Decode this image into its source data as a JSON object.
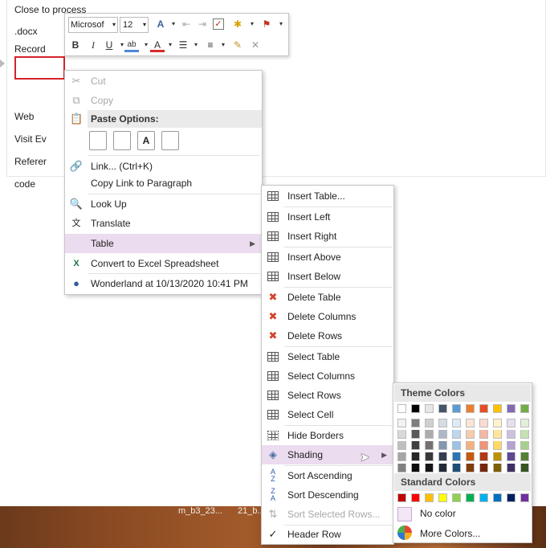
{
  "document": {
    "cells": [
      "Close to process",
      ".docx",
      "Record",
      "Web",
      "Visit Ev",
      "Referer",
      "code"
    ]
  },
  "mini_toolbar": {
    "font_name": "Microsof",
    "font_size": "12",
    "icons": [
      "grow-font-icon",
      "decrease-indent-icon",
      "increase-indent-icon",
      "checkbox-icon",
      "styles-icon",
      "flag-icon",
      "bold-icon",
      "italic-icon",
      "underline-icon",
      "highlight-icon",
      "font-color-icon",
      "bullets-icon",
      "numbering-icon",
      "format-painter-icon",
      "clear-format-icon"
    ],
    "bold": "B",
    "italic": "I",
    "underline": "U"
  },
  "context_menu": {
    "cut": "Cut",
    "copy": "Copy",
    "paste_options": "Paste Options:",
    "link": "Link...  (Ctrl+K)",
    "copy_link": "Copy Link to Paragraph",
    "look_up": "Look Up",
    "translate": "Translate",
    "table": "Table",
    "convert": "Convert to Excel Spreadsheet",
    "author": "Wonderland at 10/13/2020 10:41 PM"
  },
  "table_submenu": {
    "items": [
      "Insert Table...",
      "Insert Left",
      "Insert Right",
      "Insert Above",
      "Insert Below",
      "Delete Table",
      "Delete Columns",
      "Delete Rows",
      "Select Table",
      "Select Columns",
      "Select Rows",
      "Select Cell",
      "Hide Borders",
      "Shading",
      "Sort Ascending",
      "Sort Descending",
      "Sort Selected Rows...",
      "Header Row"
    ]
  },
  "shading_panel": {
    "theme_header": "Theme Colors",
    "standard_header": "Standard Colors",
    "no_color": "No color",
    "more_colors": "More Colors...",
    "theme_top": [
      "#ffffff",
      "#000000",
      "#e7e6e6",
      "#44546a",
      "#5b9bd5",
      "#ed7d31",
      "#e84c22",
      "#ffc000",
      "#7f6ab3",
      "#70ad47"
    ],
    "theme_columns": [
      [
        "#f2f2f2",
        "#d9d9d9",
        "#bfbfbf",
        "#a6a6a6",
        "#808080"
      ],
      [
        "#7f7f7f",
        "#595959",
        "#404040",
        "#262626",
        "#0d0d0d"
      ],
      [
        "#d0cece",
        "#aeabab",
        "#757171",
        "#3a3838",
        "#171616"
      ],
      [
        "#d6dce4",
        "#adb9ca",
        "#8497b0",
        "#333f4f",
        "#222a35"
      ],
      [
        "#deebf6",
        "#bdd7ee",
        "#9cc3e5",
        "#2e75b5",
        "#1f4e79"
      ],
      [
        "#fbe5d5",
        "#f7cbac",
        "#f4b083",
        "#c55a11",
        "#833c0b"
      ],
      [
        "#fadbd2",
        "#f5b7a5",
        "#f19379",
        "#b23914",
        "#77260d"
      ],
      [
        "#fff2cc",
        "#fee599",
        "#ffd965",
        "#bf9000",
        "#7f6000"
      ],
      [
        "#e5e0f0",
        "#ccc1e1",
        "#b2a3d1",
        "#5d4893",
        "#3e3062"
      ],
      [
        "#e2efd9",
        "#c5e0b3",
        "#a8d08d",
        "#538135",
        "#375623"
      ]
    ],
    "standard": [
      "#c00000",
      "#ff0000",
      "#ffc000",
      "#ffff00",
      "#92d050",
      "#00b050",
      "#00b0f0",
      "#0070c0",
      "#002060",
      "#7030a0"
    ]
  },
  "background": {
    "taskbar_text_1": "m_b3_23...",
    "taskbar_text_2": "21_b..."
  }
}
